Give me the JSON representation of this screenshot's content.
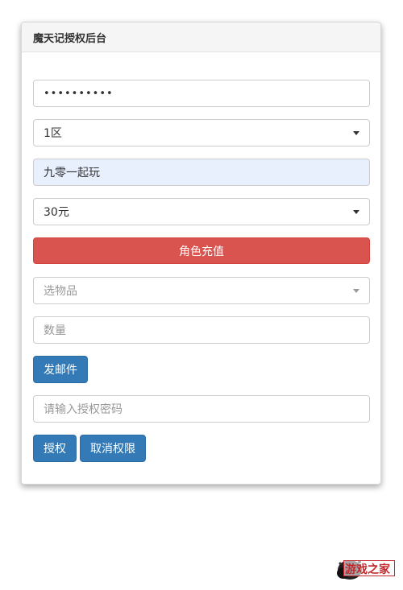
{
  "panel": {
    "title": "魔天记授权后台"
  },
  "form": {
    "password_value": "••••••••••",
    "server_select": "1区",
    "role_name_value": "九零一起玩",
    "amount_select": "30元",
    "recharge_button": "角色充值",
    "item_select_placeholder": "选物品",
    "quantity_placeholder": "数量",
    "send_mail_button": "发邮件",
    "auth_password_placeholder": "请输入授权密码",
    "authorize_button": "授权",
    "revoke_button": "取消权限"
  },
  "watermark": {
    "logo_text": "游戏之家"
  },
  "colors": {
    "danger": "#d9534f",
    "primary": "#337ab7",
    "autofill": "#e8f0fe",
    "logo_red": "#c1272d"
  }
}
